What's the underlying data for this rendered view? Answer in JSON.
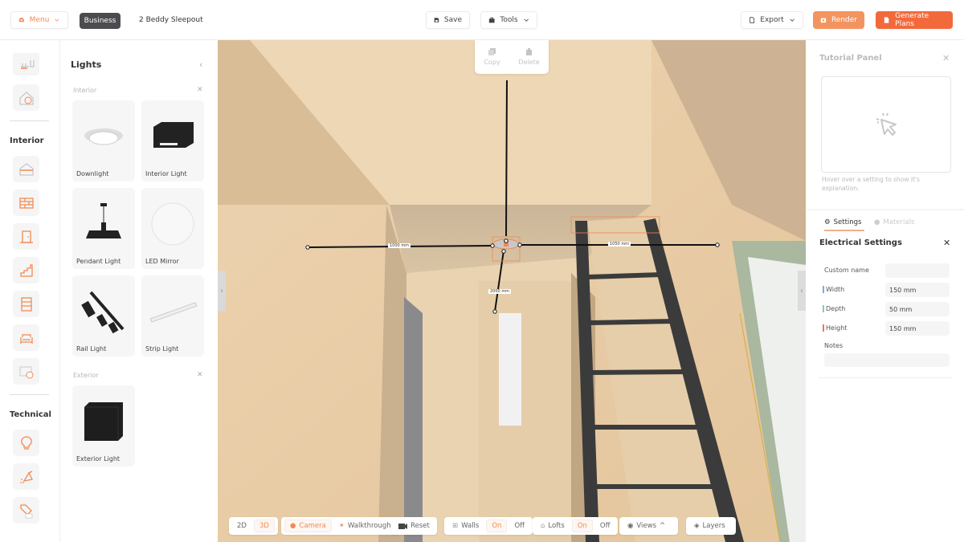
{
  "topbar": {
    "menu_label": "Menu",
    "plan_badge": "Business",
    "project_name": "2 Beddy Sleepout",
    "save_label": "Save",
    "tools_label": "Tools",
    "export_label": "Export",
    "render_label": "Render",
    "generate_label": "Generate Plans",
    "accent_color": "#f26a3c"
  },
  "iconbar": {
    "interior_label": "Interior",
    "technical_label": "Technical",
    "items": [
      {
        "name": "floorplan"
      },
      {
        "name": "exterior-paint"
      },
      {
        "name": "ceiling"
      },
      {
        "name": "wall"
      },
      {
        "name": "door"
      },
      {
        "name": "stairs"
      },
      {
        "name": "cabinet"
      },
      {
        "name": "sofa"
      },
      {
        "name": "interior-paint"
      },
      {
        "name": "lights"
      },
      {
        "name": "plumbing"
      },
      {
        "name": "tag"
      }
    ]
  },
  "lights_panel": {
    "title": "Lights",
    "interior_label": "Interior",
    "exterior_label": "Exterior",
    "interior_items": [
      "Downlight",
      "Interior Light",
      "Pendant Light",
      "LED Mirror",
      "Rail Light",
      "Strip Light"
    ],
    "exterior_items": [
      "Exterior Light"
    ]
  },
  "popup": {
    "copy_label": "Copy",
    "delete_label": "Delete"
  },
  "viewport": {
    "dimensions": {
      "left": "1000 mm",
      "right": "1050 mm",
      "down": "2000 mm"
    }
  },
  "bottom_bar": {
    "mode_2d": "2D",
    "mode_3d": "3D",
    "active_mode": "3D",
    "camera_label": "Camera",
    "walkthrough_label": "Walkthrough",
    "reset_label": "Reset",
    "walls_label": "Walls",
    "walls_on": "On",
    "walls_off": "Off",
    "lofts_label": "Lofts",
    "lofts_on": "On",
    "lofts_off": "Off",
    "views_label": "Views",
    "layers_label": "Layers"
  },
  "right_panel": {
    "tutorial_title": "Tutorial Panel",
    "tutorial_hint": "Hover over a setting to show it's explanation.",
    "settings_tab": "Settings",
    "materials_tab": "Materials",
    "section_title": "Electrical Settings",
    "fields": {
      "custom_name_label": "Custom name",
      "custom_name_value": "",
      "width_label": "Width",
      "width_value": "150 mm",
      "depth_label": "Depth",
      "depth_value": "50 mm",
      "height_label": "Height",
      "height_value": "150 mm",
      "notes_label": "Notes",
      "notes_value": ""
    },
    "axis_colors": {
      "width": "#8aa8d8",
      "depth": "#7ccfb8",
      "height": "#e07a6a"
    }
  }
}
